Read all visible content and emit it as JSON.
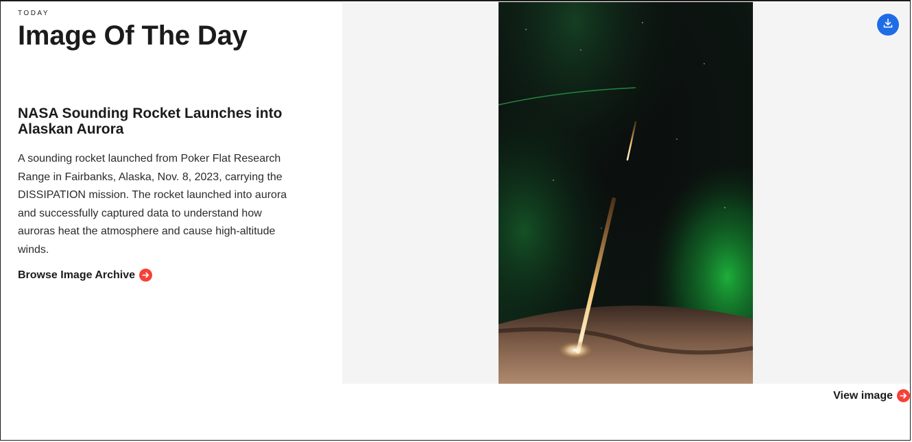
{
  "header": {
    "eyebrow": "TODAY",
    "title": "Image Of The Day"
  },
  "article": {
    "title": "NASA Sounding Rocket Launches into Alaskan Aurora",
    "description": "A sounding rocket launched from Poker Flat Research Range in Fairbanks, Alaska, Nov. 8, 2023, carrying the DISSIPATION mission. The rocket launched into aurora and successfully captured data to understand how auroras heat the atmosphere and cause high-altitude winds.",
    "archive_link": "Browse Image Archive"
  },
  "image": {
    "view_link": "View image",
    "download_icon": "download-icon",
    "arrow_icon": "arrow-right-circle-icon"
  },
  "colors": {
    "accent_red": "#f64137",
    "download_blue": "#1f6ce6",
    "panel_bg": "#f4f4f5"
  }
}
